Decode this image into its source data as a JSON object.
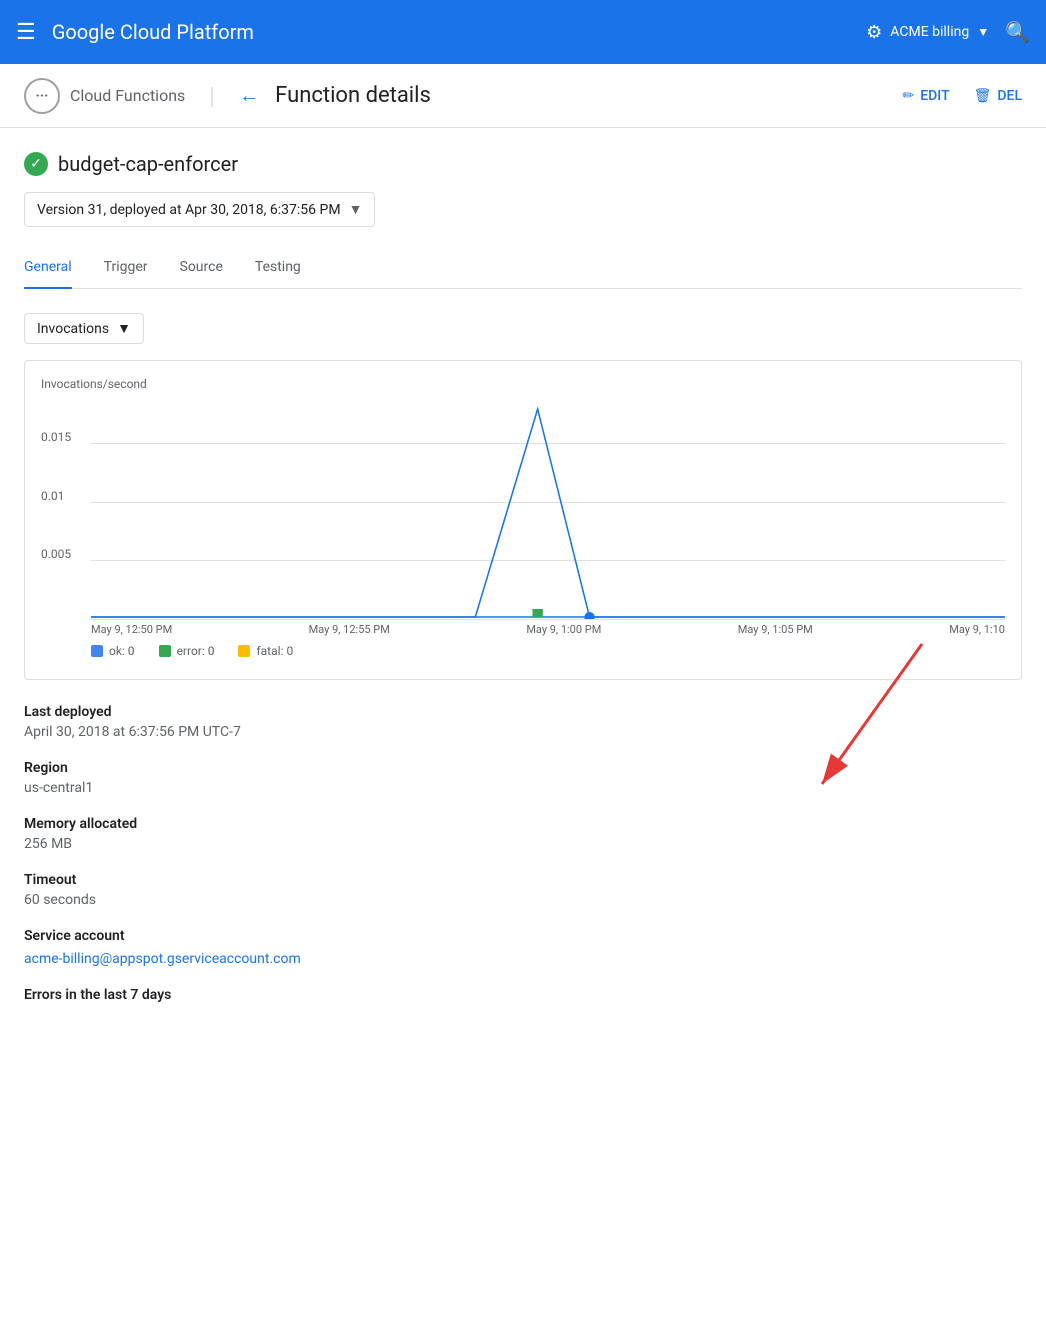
{
  "topNav": {
    "hamburger": "☰",
    "title": "Google Cloud Platform",
    "project": "ACME billing",
    "chevron": "▼",
    "searchIcon": "🔍"
  },
  "breadcrumb": {
    "logoText": "···",
    "serviceName": "Cloud Functions",
    "backArrow": "←",
    "pageTitle": "Function details",
    "editLabel": "EDIT",
    "deleteLabel": "DEL"
  },
  "function": {
    "name": "budget-cap-enforcer",
    "version": "Version 31, deployed at Apr 30, 2018, 6:37:56 PM",
    "statusIcon": "✓"
  },
  "tabs": [
    {
      "label": "General",
      "active": true
    },
    {
      "label": "Trigger",
      "active": false
    },
    {
      "label": "Source",
      "active": false
    },
    {
      "label": "Testing",
      "active": false
    }
  ],
  "chart": {
    "metricLabel": "Invocations",
    "yAxisLabel": "Invocations/second",
    "gridLines": [
      {
        "label": "0.015",
        "percent": 20
      },
      {
        "label": "0.01",
        "percent": 47
      },
      {
        "label": "0.005",
        "percent": 73
      }
    ],
    "xLabels": [
      "May 9, 12:50 PM",
      "May 9, 12:55 PM",
      "May 9, 1:00 PM",
      "May 9, 1:05 PM",
      "May 9, 1:10"
    ],
    "legend": [
      {
        "label": "ok: 0",
        "color": "#4285f4"
      },
      {
        "label": "error: 0",
        "color": "#34a853"
      },
      {
        "label": "fatal: 0",
        "color": "#fbbc04"
      }
    ]
  },
  "details": {
    "lastDeployedLabel": "Last deployed",
    "lastDeployedValue": "April 30, 2018 at 6:37:56 PM UTC-7",
    "regionLabel": "Region",
    "regionValue": "us-central1",
    "memoryLabel": "Memory allocated",
    "memoryValue": "256 MB",
    "timeoutLabel": "Timeout",
    "timeoutValue": "60 seconds",
    "serviceAccountLabel": "Service account",
    "serviceAccountValue": "acme-billing@appspot.gserviceaccount.com",
    "errorsLabel": "Errors in the last 7 days"
  }
}
